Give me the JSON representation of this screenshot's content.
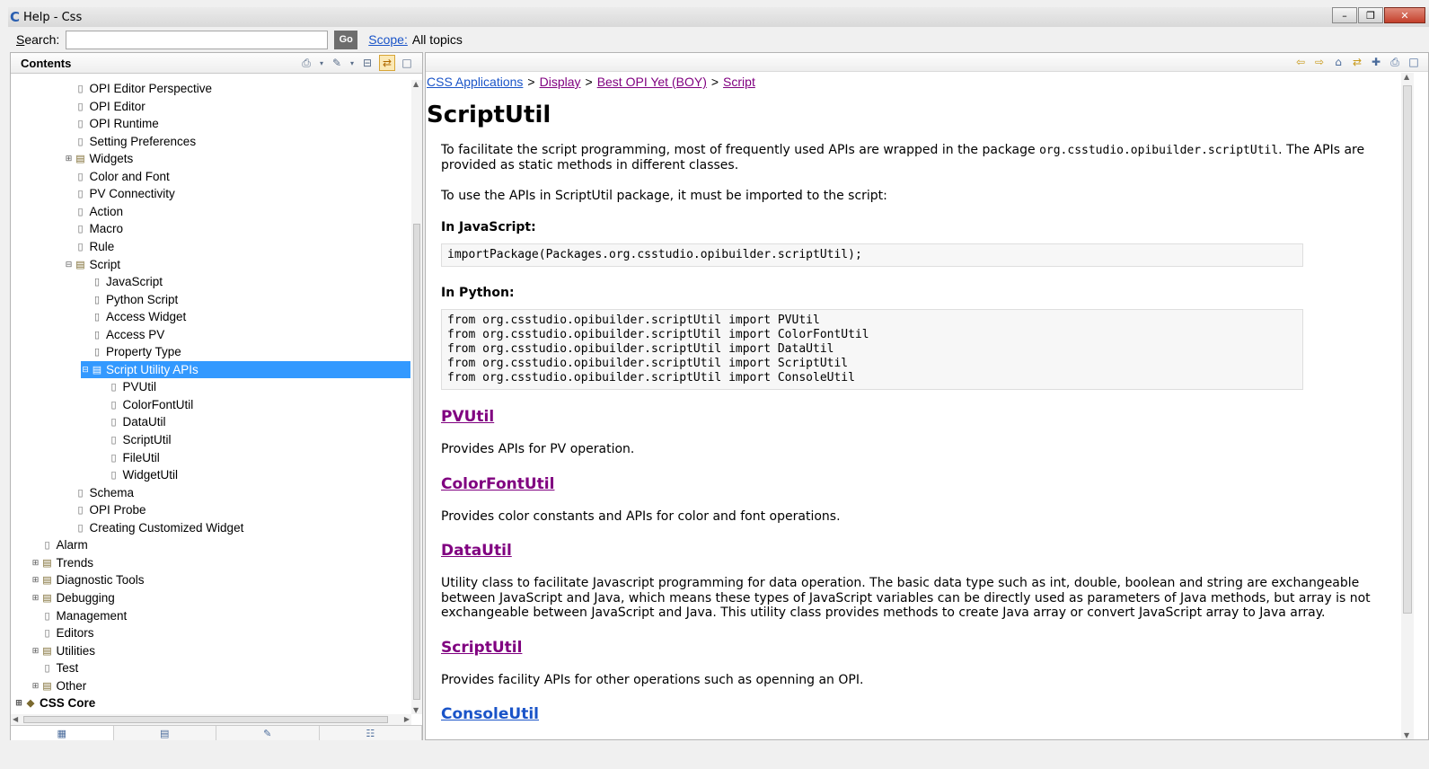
{
  "window": {
    "title": "Help - Css",
    "minimize": "–",
    "maximize": "❐",
    "close": "✕"
  },
  "search": {
    "label_underlined": "S",
    "label_rest": "earch:",
    "value": "",
    "go_label": "Go",
    "scope_label": "Scope:",
    "scope_value": "All topics"
  },
  "contents": {
    "title": "Contents",
    "tree": [
      {
        "label": "OPI Editor Perspective",
        "indent": 3,
        "type": "page",
        "expander": ""
      },
      {
        "label": "OPI Editor",
        "indent": 3,
        "type": "page",
        "expander": ""
      },
      {
        "label": "OPI Runtime",
        "indent": 3,
        "type": "page",
        "expander": ""
      },
      {
        "label": "Setting Preferences",
        "indent": 3,
        "type": "page",
        "expander": ""
      },
      {
        "label": "Widgets",
        "indent": 3,
        "type": "book",
        "expander": "⊞"
      },
      {
        "label": "Color and Font",
        "indent": 3,
        "type": "page",
        "expander": ""
      },
      {
        "label": "PV Connectivity",
        "indent": 3,
        "type": "page",
        "expander": ""
      },
      {
        "label": "Action",
        "indent": 3,
        "type": "page",
        "expander": ""
      },
      {
        "label": "Macro",
        "indent": 3,
        "type": "page",
        "expander": ""
      },
      {
        "label": "Rule",
        "indent": 3,
        "type": "page",
        "expander": ""
      },
      {
        "label": "Script",
        "indent": 3,
        "type": "book",
        "expander": "⊟"
      },
      {
        "label": "JavaScript",
        "indent": 4,
        "type": "page",
        "expander": ""
      },
      {
        "label": "Python Script",
        "indent": 4,
        "type": "page",
        "expander": ""
      },
      {
        "label": "Access Widget",
        "indent": 4,
        "type": "page",
        "expander": ""
      },
      {
        "label": "Access PV",
        "indent": 4,
        "type": "page",
        "expander": ""
      },
      {
        "label": "Property Type",
        "indent": 4,
        "type": "page",
        "expander": ""
      },
      {
        "label": "Script Utility APIs",
        "indent": 4,
        "type": "book",
        "expander": "⊟",
        "selected": true
      },
      {
        "label": "PVUtil",
        "indent": 5,
        "type": "page",
        "expander": ""
      },
      {
        "label": "ColorFontUtil",
        "indent": 5,
        "type": "page",
        "expander": ""
      },
      {
        "label": "DataUtil",
        "indent": 5,
        "type": "page",
        "expander": ""
      },
      {
        "label": "ScriptUtil",
        "indent": 5,
        "type": "page",
        "expander": ""
      },
      {
        "label": "FileUtil",
        "indent": 5,
        "type": "page",
        "expander": ""
      },
      {
        "label": "WidgetUtil",
        "indent": 5,
        "type": "page",
        "expander": ""
      },
      {
        "label": "Schema",
        "indent": 3,
        "type": "page",
        "expander": ""
      },
      {
        "label": "OPI Probe",
        "indent": 3,
        "type": "page",
        "expander": ""
      },
      {
        "label": "Creating Customized Widget",
        "indent": 3,
        "type": "page",
        "expander": ""
      },
      {
        "label": "Alarm",
        "indent": 1,
        "type": "page",
        "expander": ""
      },
      {
        "label": "Trends",
        "indent": 1,
        "type": "book",
        "expander": "⊞"
      },
      {
        "label": "Diagnostic Tools",
        "indent": 1,
        "type": "book",
        "expander": "⊞"
      },
      {
        "label": "Debugging",
        "indent": 1,
        "type": "book",
        "expander": "⊞"
      },
      {
        "label": "Management",
        "indent": 1,
        "type": "page",
        "expander": ""
      },
      {
        "label": "Editors",
        "indent": 1,
        "type": "page",
        "expander": ""
      },
      {
        "label": "Utilities",
        "indent": 1,
        "type": "book",
        "expander": "⊞"
      },
      {
        "label": "Test",
        "indent": 1,
        "type": "page",
        "expander": ""
      },
      {
        "label": "Other",
        "indent": 1,
        "type": "book",
        "expander": "⊞"
      },
      {
        "label": "CSS Core",
        "indent": 0,
        "type": "toc",
        "expander": "⊞",
        "bold": true
      }
    ],
    "toolbar_icons": [
      "print-icon",
      "dropdown-icon",
      "link-icon",
      "dropdown-icon",
      "collapse-all-icon",
      "link-with-editor-icon",
      "maximize-icon"
    ],
    "bottom_tabs": [
      "contents-tab-icon",
      "index-tab-icon",
      "search-results-tab-icon",
      "bookmarks-tab-icon"
    ]
  },
  "content": {
    "breadcrumb": [
      {
        "label": "CSS Applications",
        "visited": false
      },
      {
        "label": "Display",
        "visited": true
      },
      {
        "label": "Best OPI Yet (BOY)",
        "visited": true
      },
      {
        "label": "Script",
        "visited": true
      }
    ],
    "separator": ">",
    "title": "ScriptUtil",
    "intro_before": "To facilitate the script programming, most of frequently used APIs are wrapped in the package ",
    "intro_code": "org.csstudio.opibuilder.scriptUtil",
    "intro_after": ". The APIs are provided as static methods in different classes.",
    "import_note": "To use the APIs in ScriptUtil package, it must be imported to the script:",
    "js_heading": "In JavaScript:",
    "js_code": "importPackage(Packages.org.csstudio.opibuilder.scriptUtil);",
    "py_heading": "In Python:",
    "py_code": "from org.csstudio.opibuilder.scriptUtil import PVUtil\nfrom org.csstudio.opibuilder.scriptUtil import ColorFontUtil\nfrom org.csstudio.opibuilder.scriptUtil import DataUtil\nfrom org.csstudio.opibuilder.scriptUtil import ScriptUtil\nfrom org.csstudio.opibuilder.scriptUtil import ConsoleUtil",
    "apis": [
      {
        "name": "PVUtil",
        "desc": "Provides APIs for PV operation."
      },
      {
        "name": "ColorFontUtil",
        "desc": "Provides color constants and APIs for color and font operations."
      },
      {
        "name": "DataUtil",
        "desc": "Utility class to facilitate Javascript programming for data operation. The basic data type such as int, double, boolean and string are exchangeable between JavaScript and Java, which means these types of JavaScript variables can be directly used as parameters of Java methods, but array is not exchangeable between JavaScript and Java. This utility class provides methods to create Java array or convert JavaScript array to Java array."
      },
      {
        "name": "ScriptUtil",
        "desc": "Provides facility APIs for other operations such as openning an OPI."
      },
      {
        "name": "ConsoleUtil",
        "desc": ""
      }
    ]
  },
  "colors": {
    "selection": "#3399ff",
    "link": "#1a54c8",
    "visited": "#800080"
  }
}
